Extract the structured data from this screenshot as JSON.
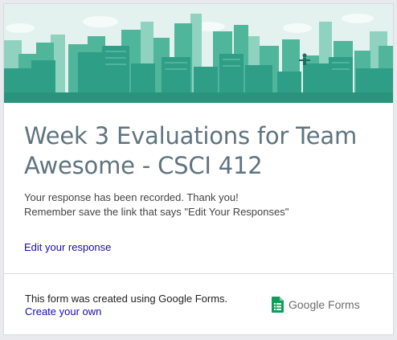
{
  "form": {
    "title": "Week 3 Evaluations for Team Awesome - CSCI 412",
    "confirmation_line1": "Your response has been recorded. Thank you!",
    "confirmation_line2": "Remember save the link that says \"Edit Your Responses\"",
    "edit_link": "Edit your response"
  },
  "footer": {
    "created_text": "This form was created using Google Forms.",
    "create_link": "Create your own",
    "logo_google": "Google",
    "logo_forms": "Forms"
  },
  "colors": {
    "banner_sky": "#e4f3ef",
    "banner_buildings": "#2f9e86",
    "title": "#5f7480",
    "link": "#1a0dab",
    "forms_green": "#0f9d58"
  },
  "icons": {
    "banner": "city-skyline-illustration",
    "logo": "google-forms-icon"
  }
}
